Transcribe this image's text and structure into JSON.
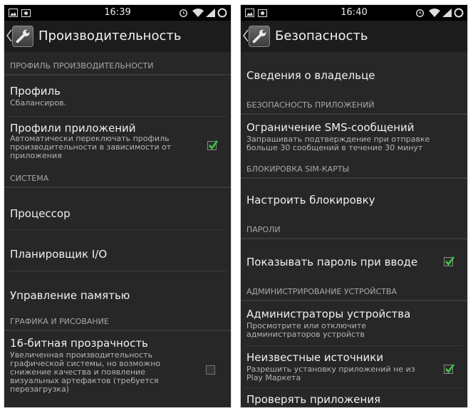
{
  "left_screen": {
    "status_time": "16:39",
    "title": "Производительность",
    "sections": {
      "performance_profile": "ПРОФИЛЬ ПРОИЗВОДИТЕЛЬНОСТИ",
      "system": "СИСТЕМА",
      "graphics": "ГРАФИКА И РИСОВАНИЕ"
    },
    "items": {
      "profile": {
        "title": "Профиль",
        "summary": "Сбалансиров."
      },
      "app_profiles": {
        "title": "Профили приложений",
        "summary": "Автоматически переключать профиль производительности в зависимости от приложения",
        "checked": true
      },
      "processor": {
        "title": "Процессор"
      },
      "io_scheduler": {
        "title": "Планировщик I/O"
      },
      "memory": {
        "title": "Управление памятью"
      },
      "transparency": {
        "title": "16-битная прозрачность",
        "summary": "Увеличенная производительность графической системы, но возможно снижение качества и появление визуальных артефактов (требуется перезагрузка)",
        "checked": false
      }
    }
  },
  "right_screen": {
    "status_time": "16:40",
    "title": "Безопасность",
    "sections": {
      "app_security": "БЕЗОПАСНОСТЬ ПРИЛОЖЕНИЙ",
      "sim_lock": "БЛОКИРОВКА SIM-КАРТЫ",
      "passwords": "ПАРОЛИ",
      "device_admin": "АДМИНИСТРИРОВАНИЕ УСТРОЙСТВА"
    },
    "items": {
      "owner_info": {
        "title": "Сведения о владельце"
      },
      "sms_limit": {
        "title": "Ограничение SMS-сообщений",
        "summary": "Запрашивать подтверждение при отправке больше 30 сообщений в течение 30 минут"
      },
      "setup_lock": {
        "title": "Настроить блокировку"
      },
      "show_password": {
        "title": "Показывать пароль при вводе",
        "checked": true
      },
      "device_admins": {
        "title": "Администраторы устройства",
        "summary": "Просмотрите или отключите администраторов устройств"
      },
      "unknown_sources": {
        "title": "Неизвестные источники",
        "summary": "Разрешить установку приложений не из Play Маркета",
        "checked": true
      },
      "verify_apps": {
        "title": "Проверять приложения"
      }
    }
  },
  "colors": {
    "background": "#272727",
    "statusbar": "#000000",
    "accent_check": "#3cc83c",
    "section_text": "#a8a8a8"
  },
  "icons": [
    "image-icon",
    "photo-icon",
    "alarm-icon",
    "wifi-icon",
    "signal-icon",
    "battery-icon",
    "wrench-icon",
    "chevron-left-icon",
    "checkmark-icon"
  ]
}
